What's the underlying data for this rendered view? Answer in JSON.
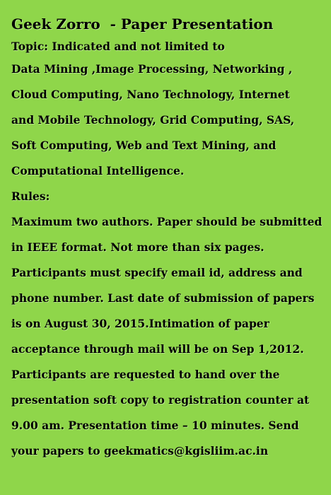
{
  "title": "Geek Zorro  - Paper Presentation",
  "topic_lines": [
    "Topic: Indicated and not limited to",
    "Data Mining ,Image Processing, Networking ,",
    "Cloud Computing, Nano Technology, Internet",
    "and Mobile Technology, Grid Computing, SAS,",
    "Soft Computing, Web and Text Mining, and",
    "Computational Intelligence."
  ],
  "rules_heading": "Rules:",
  "rules_lines": [
    "Maximum two authors. Paper should be submitted",
    "in IEEE format. Not more than six pages.",
    "Participants must specify email id, address and",
    "phone number. Last date of submission of papers",
    "is on August 30, 2015.Intimation of paper",
    "acceptance through mail will be on Sep 1,2012.",
    "Participants are requested to hand over the",
    "presentation soft copy to registration counter at",
    "9.00 am. Presentation time – 10 minutes. Send",
    "your papers to geekmatics@kgisliim.ac.in"
  ],
  "colors": {
    "background": "#8fd64a",
    "text": "#000000"
  }
}
